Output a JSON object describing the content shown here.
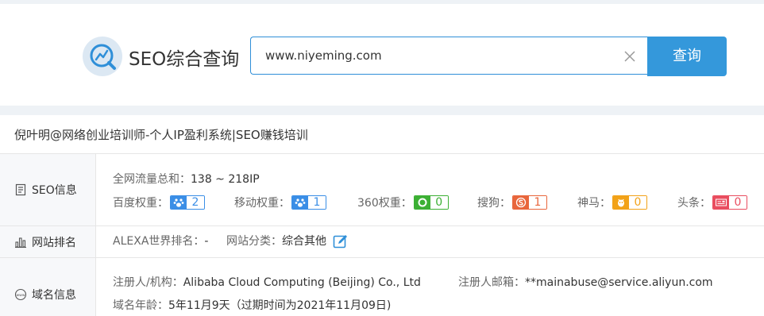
{
  "header": {
    "logo_text": "SEO综合查询",
    "search": {
      "value": "www.niyeming.com"
    },
    "search_button": "查询"
  },
  "site": {
    "title": "倪叶明@网络创业培训师-个人IP盈利系统|SEO赚钱培训"
  },
  "seo_info": {
    "label": "SEO信息",
    "traffic_label": "全网流量总和：",
    "traffic_value": "138 ~ 218IP",
    "metrics": [
      {
        "label": "百度权重：",
        "value": "2",
        "icon": "baidu-paw-icon",
        "color": "#3a8ee6"
      },
      {
        "label": "移动权重：",
        "value": "1",
        "icon": "baidu-paw-icon",
        "color": "#3a8ee6"
      },
      {
        "label": "360权重：",
        "value": "0",
        "icon": "360-icon",
        "color": "#3cb034"
      },
      {
        "label": "搜狗：",
        "value": "1",
        "icon": "sogou-icon",
        "color": "#e8663c"
      },
      {
        "label": "神马：",
        "value": "0",
        "icon": "shenma-icon",
        "color": "#f2a218"
      },
      {
        "label": "头条：",
        "value": "0",
        "icon": "toutiao-icon",
        "color": "#e94d5f"
      }
    ]
  },
  "ranking": {
    "label": "网站排名",
    "alexa_label": "ALEXA世界排名：",
    "alexa_value": "-",
    "category_label": "网站分类：",
    "category_value": "综合其他"
  },
  "domain": {
    "label": "域名信息",
    "registrant_label": "注册人/机构：",
    "registrant_value": "Alibaba Cloud Computing (Beijing) Co., Ltd",
    "email_label": "注册人邮箱：",
    "email_value": "**mainabuse@service.aliyun.com",
    "age_label": "域名年龄：",
    "age_value": "5年11月9天（过期时间为2021年11月09日)"
  },
  "colors": {
    "accent": "#3498db",
    "border": "#2f8fd8"
  }
}
